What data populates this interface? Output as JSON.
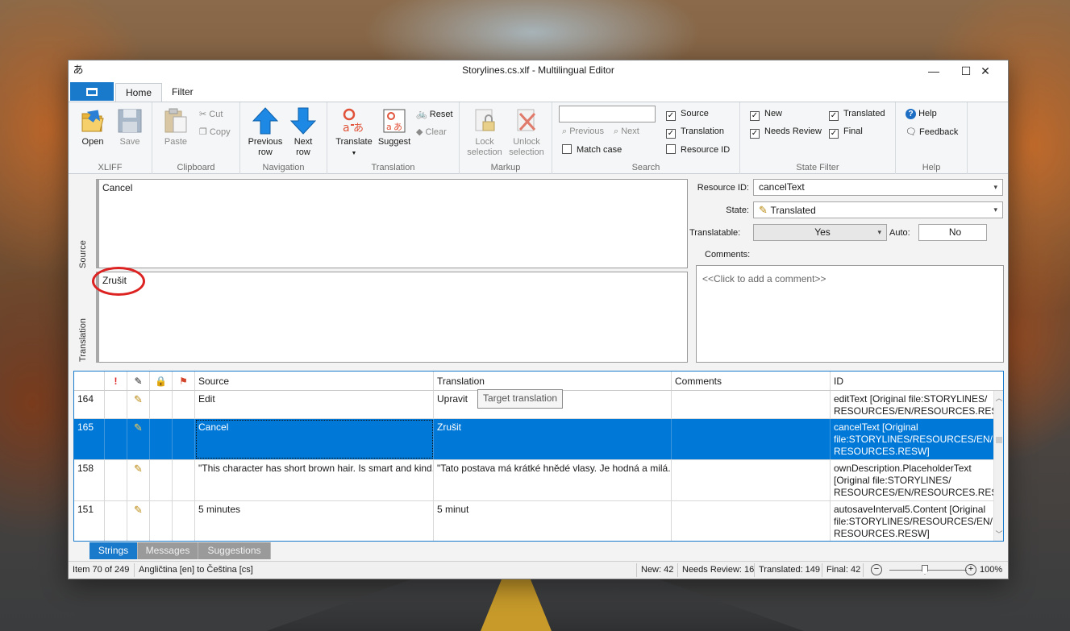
{
  "window": {
    "title": "Storylines.cs.xlf - Multilingual Editor"
  },
  "ribbon_tabs": [
    "Home",
    "Filter"
  ],
  "ribbon": {
    "xliff": {
      "label": "XLIFF",
      "open": "Open",
      "save": "Save"
    },
    "clipboard": {
      "label": "Clipboard",
      "paste": "Paste",
      "cut": "Cut",
      "copy": "Copy"
    },
    "navigation": {
      "label": "Navigation",
      "previous_line1": "Previous",
      "previous_line2": "row",
      "next_line1": "Next",
      "next_line2": "row"
    },
    "translation": {
      "label": "Translation",
      "translate": "Translate",
      "suggest": "Suggest",
      "reset": "Reset",
      "clear": "Clear"
    },
    "markup": {
      "label": "Markup",
      "lock_line1": "Lock",
      "lock_line2": "selection",
      "unlock_line1": "Unlock",
      "unlock_line2": "selection"
    },
    "search": {
      "label": "Search",
      "query": "",
      "previous": "Previous",
      "next": "Next",
      "match_case": "Match case",
      "source": "Source",
      "translation": "Translation",
      "resource_id": "Resource ID"
    },
    "state_filter": {
      "label": "State Filter",
      "new": "New",
      "needs_review": "Needs Review",
      "translated": "Translated",
      "final": "Final"
    },
    "help": {
      "label": "Help",
      "help": "Help",
      "feedback": "Feedback"
    }
  },
  "editor": {
    "source_label": "Source",
    "translation_label": "Translation",
    "source_text": "Cancel",
    "translation_text": "Zrušit"
  },
  "properties": {
    "resource_id_label": "Resource ID:",
    "resource_id_value": "cancelText",
    "state_label": "State:",
    "state_value": "Translated",
    "translatable_label": "Translatable:",
    "translatable_value": "Yes",
    "auto_label": "Auto:",
    "auto_value": "No",
    "comments_label": "Comments:",
    "comments_placeholder": "<<Click to add a comment>>"
  },
  "grid": {
    "headers": {
      "source": "Source",
      "translation": "Translation",
      "comments": "Comments",
      "id": "ID"
    },
    "tooltip": "Target translation",
    "rows": [
      {
        "num": "164",
        "source": "Edit",
        "translation": "Upravit",
        "comments": "",
        "id": "editText [Original file:STORYLINES/ RESOURCES/EN/RESOURCES.RESW]"
      },
      {
        "num": "165",
        "source": "Cancel",
        "translation": "Zrušit",
        "comments": "",
        "id": "cancelText [Original file:STORYLINES/RESOURCES/EN/ RESOURCES.RESW]"
      },
      {
        "num": "158",
        "source": "\"This character has short brown hair. Is smart and kind...",
        "translation": "\"Tato postava má krátké hnědé vlasy. Je hodná a milá...\"",
        "comments": "",
        "id": "ownDescription.PlaceholderText [Original file:STORYLINES/ RESOURCES/EN/RESOURCES.RESW]"
      },
      {
        "num": "151",
        "source": "5 minutes",
        "translation": "5 minut",
        "comments": "",
        "id": "autosaveInterval5.Content [Original file:STORYLINES/RESOURCES/EN/ RESOURCES.RESW]"
      }
    ]
  },
  "bottom_tabs": [
    "Strings",
    "Messages",
    "Suggestions"
  ],
  "status": {
    "position": "Item 70 of 249",
    "languages": "Angličtina [en] to Čeština [cs]",
    "new": "New: 42",
    "needs_review": "Needs Review: 16",
    "translated": "Translated: 149",
    "final": "Final: 42",
    "zoom": "100%"
  }
}
